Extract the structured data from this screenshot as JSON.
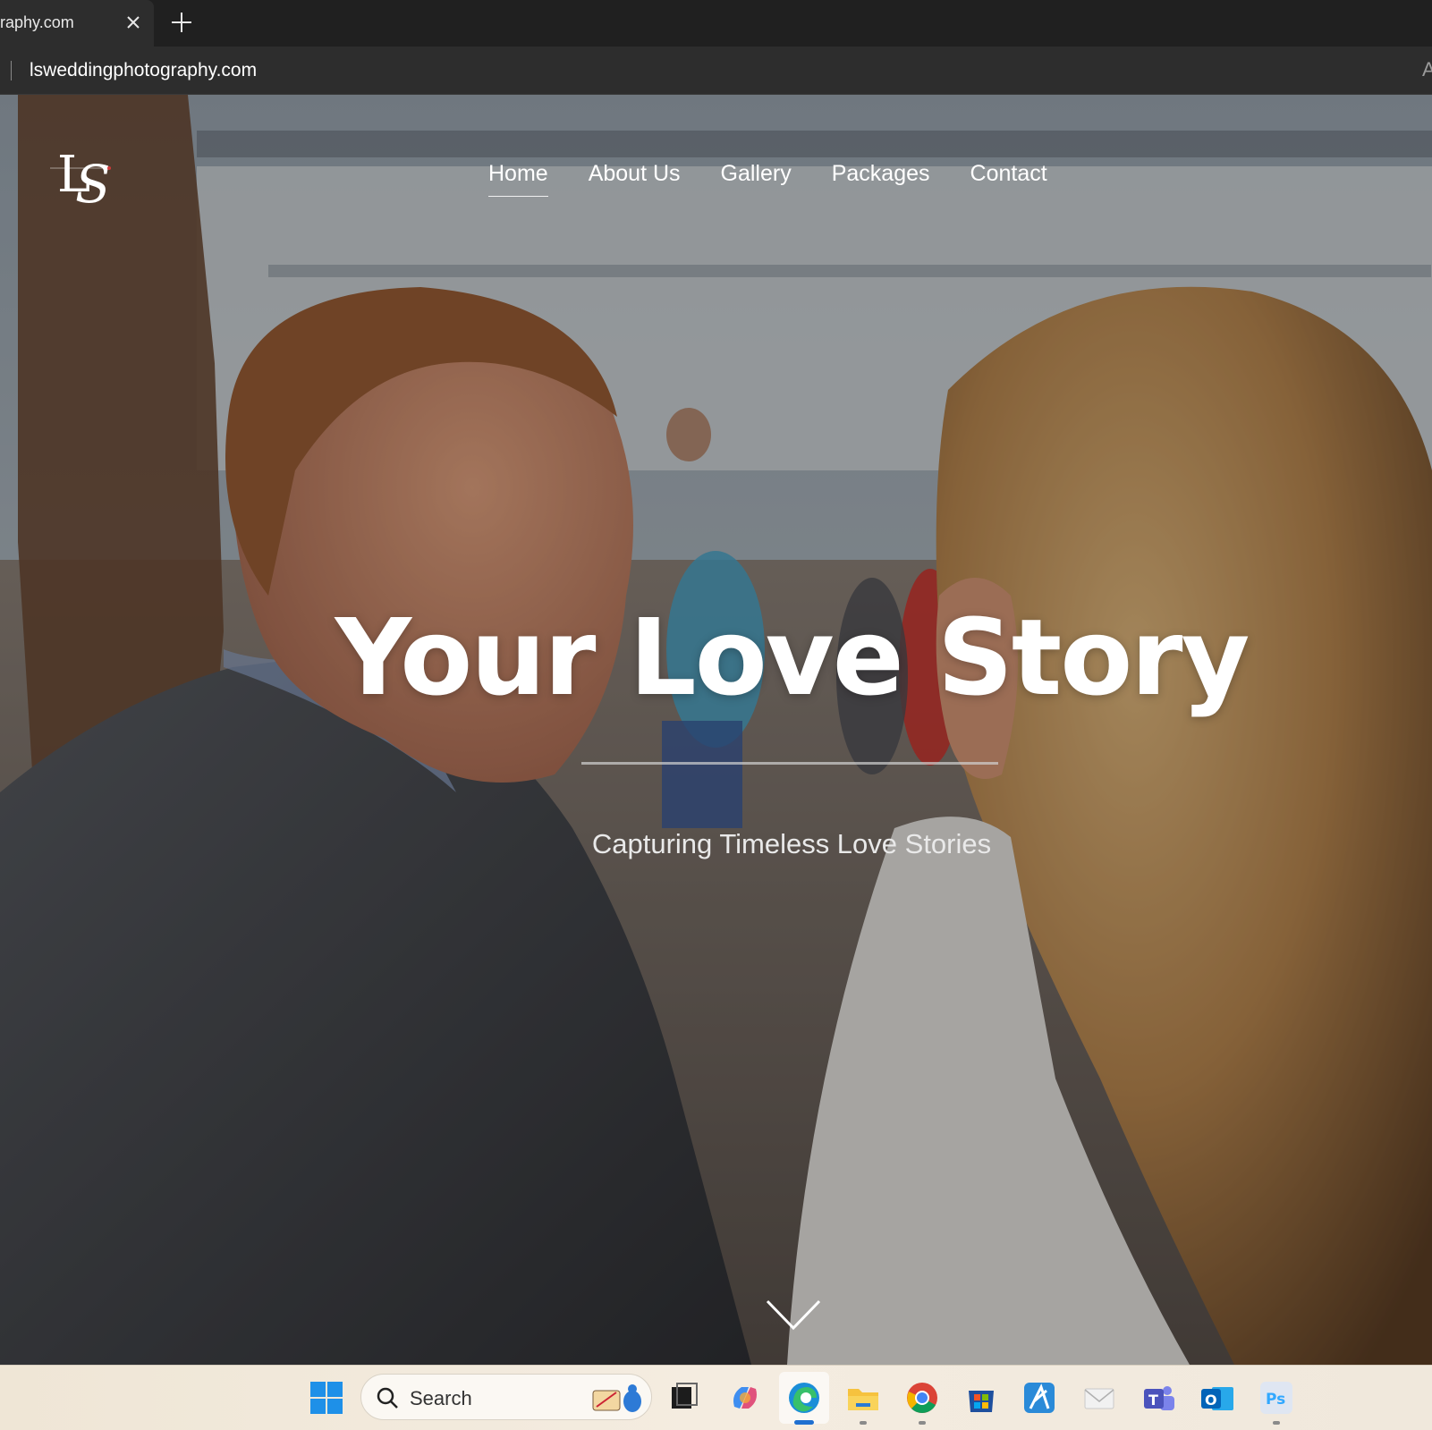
{
  "browser": {
    "tab_title": "raphy.com",
    "url": "lsweddingphotography.com",
    "right_glyph": "A"
  },
  "site": {
    "logo_alt": "LS love story logo",
    "nav": [
      {
        "label": "Home",
        "active": true
      },
      {
        "label": "About Us",
        "active": false
      },
      {
        "label": "Gallery",
        "active": false
      },
      {
        "label": "Packages",
        "active": false
      },
      {
        "label": "Contact",
        "active": false
      }
    ],
    "hero": {
      "title": "Your Love Story",
      "subtitle": "Capturing Timeless Love Stories"
    }
  },
  "taskbar": {
    "search_placeholder": "Search",
    "apps": [
      "windows-start",
      "search",
      "task-view",
      "copilot",
      "edge",
      "file-explorer",
      "chrome",
      "microsoft-store",
      "app-a",
      "mail",
      "teams",
      "outlook",
      "photoshop"
    ],
    "active_app": "edge"
  },
  "colors": {
    "tabbar": "#202020",
    "addressbar": "#2d2d2d",
    "taskbar": "#efe6d6",
    "accent": "#1f6fd0"
  }
}
